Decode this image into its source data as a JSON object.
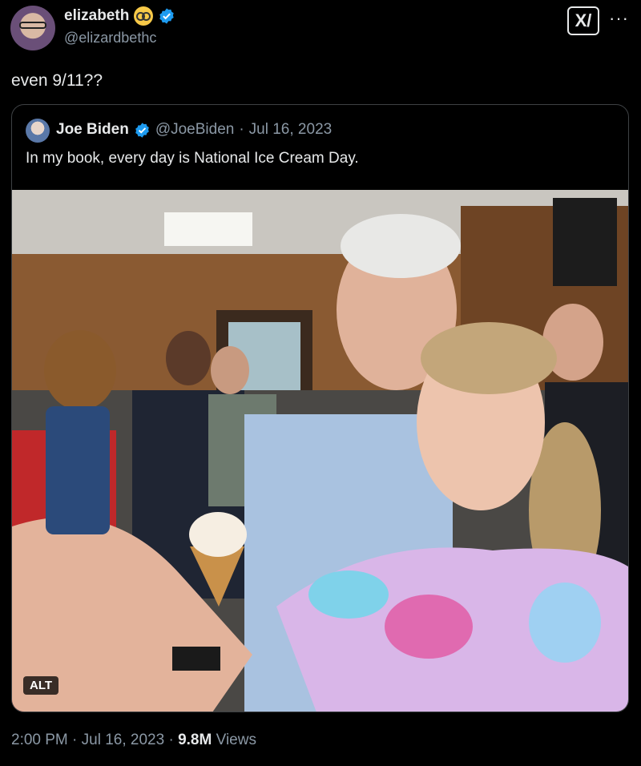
{
  "author": {
    "name": "elizabeth",
    "emoji": "nerd-face-emoji",
    "handle": "@elizardbethc"
  },
  "tweet": {
    "text": "even 9/11??"
  },
  "actions": {
    "grok_label": "X/",
    "more_label": "···"
  },
  "quoted": {
    "name": "Joe Biden",
    "handle": "@JoeBiden",
    "separator": "·",
    "date": "Jul 16, 2023",
    "text": "In my book, every day is National Ice Cream Day.",
    "image": {
      "alt_badge": "ALT",
      "description_icon": "photo-image"
    }
  },
  "footer": {
    "time": "2:00 PM",
    "separator": "·",
    "date": "Jul 16, 2023",
    "views_count": "9.8M",
    "views_label": "Views"
  },
  "colors": {
    "background": "#000000",
    "text": "#e7e9ea",
    "secondary": "#8b98a5",
    "verified": "#1d9bf0",
    "border": "#3e4144"
  }
}
